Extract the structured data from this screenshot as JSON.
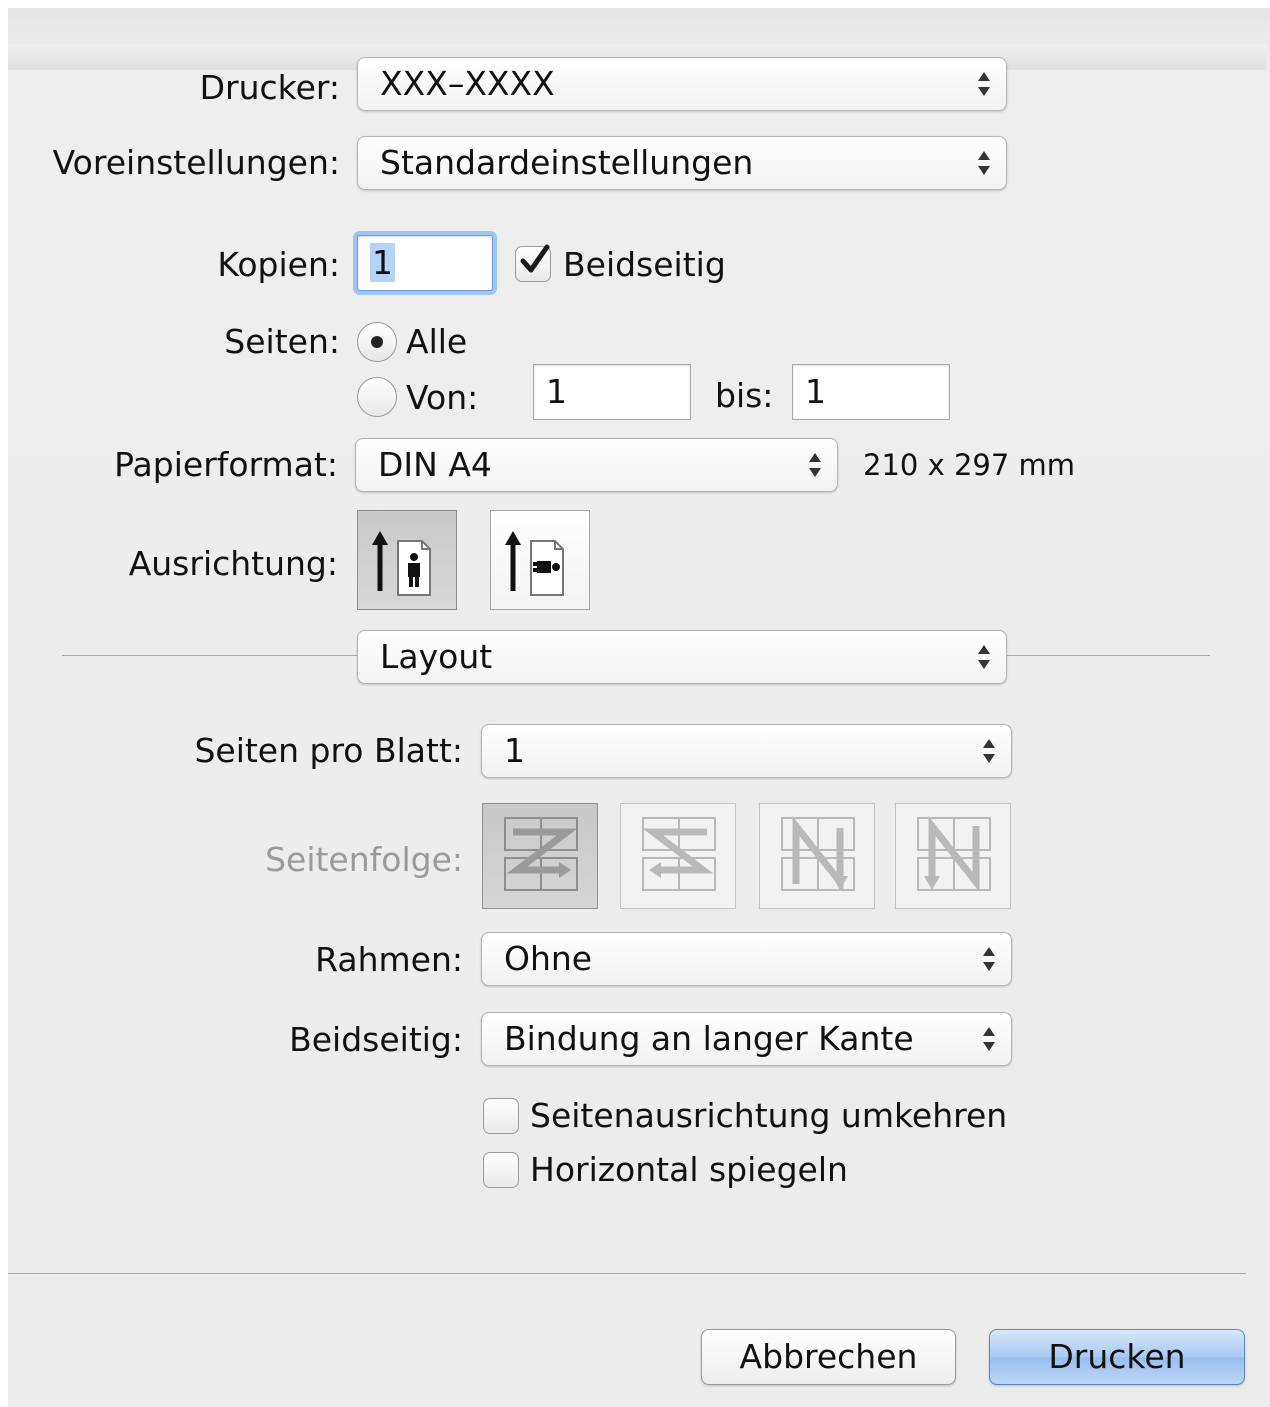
{
  "printer": {
    "label": "Drucker:",
    "value": "XXX–XXXX"
  },
  "presets": {
    "label": "Voreinstellungen:",
    "value": "Standardeinstellungen"
  },
  "copies": {
    "label": "Kopien:",
    "value": "1",
    "duplex_label": "Beidseitig",
    "duplex_checked": true
  },
  "pages": {
    "label": "Seiten:",
    "all_label": "Alle",
    "from_label": "Von:",
    "from_value": "1",
    "to_label": "bis:",
    "to_value": "1",
    "selected": "all"
  },
  "paper": {
    "label": "Papierformat:",
    "value": "DIN A4",
    "dimensions": "210 x 297 mm"
  },
  "orientation": {
    "label": "Ausrichtung:",
    "options": [
      "portrait",
      "landscape"
    ],
    "selected": "portrait"
  },
  "section": {
    "value": "Layout"
  },
  "layout": {
    "pages_per_sheet": {
      "label": "Seiten pro Blatt:",
      "value": "1"
    },
    "page_order": {
      "label": "Seitenfolge:",
      "enabled": false,
      "options": [
        "Z-order-icon",
        "reverse-S-order-icon",
        "N-reverse-order-icon",
        "N-order-icon"
      ],
      "selected": 0
    },
    "border": {
      "label": "Rahmen:",
      "value": "Ohne"
    },
    "duplex": {
      "label": "Beidseitig:",
      "value": "Bindung an langer Kante"
    },
    "reverse_orientation": {
      "label": "Seitenausrichtung umkehren",
      "checked": false
    },
    "flip_horizontal": {
      "label": "Horizontal spiegeln",
      "checked": false
    }
  },
  "buttons": {
    "cancel": "Abbrechen",
    "print": "Drucken"
  },
  "colors": {
    "default_button": "#a9c9f1",
    "focus_ring": "#9ec4f0"
  }
}
